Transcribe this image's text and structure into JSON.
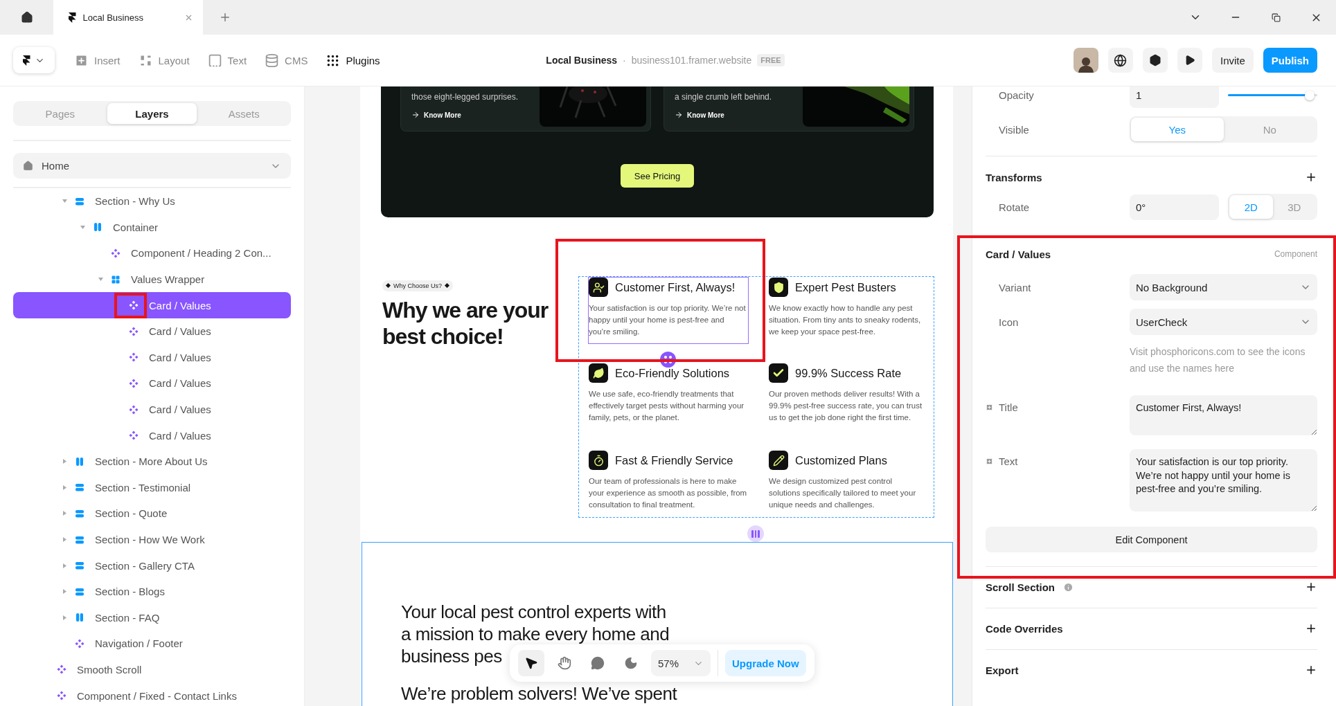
{
  "browser": {
    "tab": {
      "title": "Local Business",
      "selected": true
    }
  },
  "toolbar": {
    "tools": [
      {
        "kind": "insert",
        "label": "Insert",
        "active": false
      },
      {
        "kind": "layout",
        "label": "Layout",
        "active": false
      },
      {
        "kind": "text",
        "label": "Text",
        "active": false
      },
      {
        "kind": "cms",
        "label": "CMS",
        "active": false
      },
      {
        "kind": "plugins",
        "label": "Plugins",
        "active": true
      }
    ],
    "project": {
      "name": "Local Business",
      "separator": "·",
      "url": "business101.framer.website",
      "plan": "FREE"
    },
    "invite": "Invite",
    "publish": "Publish"
  },
  "sidebar": {
    "tabs": [
      {
        "label": "Pages",
        "selected": false
      },
      {
        "label": "Layers",
        "selected": true
      },
      {
        "label": "Assets",
        "selected": false
      }
    ],
    "page": "Home",
    "scrolled_group": [
      {
        "label": "Section - Why Us",
        "kind": "stack",
        "expanded": true,
        "selected": false,
        "children": [
          {
            "label": "Container",
            "kind": "columns",
            "expanded": true,
            "selected": false,
            "children": [
              {
                "label": "Component / Heading 2 Con...",
                "kind": "component",
                "selected": false
              },
              {
                "label": "Values Wrapper",
                "kind": "grid",
                "expanded": true,
                "selected": false,
                "children": [
                  {
                    "label": "Card / Values",
                    "kind": "component",
                    "selected": true
                  },
                  {
                    "label": "Card / Values",
                    "kind": "component",
                    "selected": false
                  },
                  {
                    "label": "Card / Values",
                    "kind": "component",
                    "selected": false
                  },
                  {
                    "label": "Card / Values",
                    "kind": "component",
                    "selected": false
                  },
                  {
                    "label": "Card / Values",
                    "kind": "component",
                    "selected": false
                  },
                  {
                    "label": "Card / Values",
                    "kind": "component",
                    "selected": false
                  }
                ]
              }
            ]
          }
        ]
      },
      {
        "label": "Section - More About Us",
        "kind": "columns",
        "expanded": false,
        "selected": false
      },
      {
        "label": "Section - Testimonial",
        "kind": "stack",
        "expanded": false,
        "selected": false
      },
      {
        "label": "Section - Quote",
        "kind": "stack",
        "expanded": false,
        "selected": false
      },
      {
        "label": "Section - How We Work",
        "kind": "stack",
        "expanded": false,
        "selected": false
      },
      {
        "label": "Section - Gallery CTA",
        "kind": "stack",
        "expanded": false,
        "selected": false
      },
      {
        "label": "Section - Blogs",
        "kind": "stack",
        "expanded": false,
        "selected": false
      },
      {
        "label": "Section - FAQ",
        "kind": "columns",
        "expanded": false,
        "selected": false
      },
      {
        "label": "Navigation / Footer",
        "kind": "component",
        "selected": false
      }
    ],
    "layers": [
      {
        "label": "Smooth Scroll",
        "kind": "component",
        "selected": false
      },
      {
        "label": "Component / Fixed - Contact Links",
        "kind": "component",
        "selected": false
      }
    ]
  },
  "canvas": {
    "services": [
      {
        "text": "those eight-legged surprises.",
        "link": "Know More"
      },
      {
        "text": "a single crumb left behind.",
        "link": "Know More"
      }
    ],
    "cta": "See Pricing",
    "why": {
      "tag": "Why Choose Us?",
      "heading": "Why we are your best choice!",
      "values": [
        {
          "kind": "user-check",
          "title": "Customer First, Always!",
          "text": "Your satisfaction is our top priority. We’re not happy until your home is pest-free and you’re smiling.",
          "selected": true
        },
        {
          "kind": "shield",
          "title": "Expert Pest Busters",
          "text": "We know exactly how to handle any pest situation. From tiny ants to sneaky rodents, we keep your space pest-free.",
          "selected": false
        },
        {
          "kind": "leaf",
          "title": "Eco-Friendly Solutions",
          "text": "We use safe, eco-friendly treatments that effectively target pests without harming your family, pets, or the planet.",
          "selected": false
        },
        {
          "kind": "check",
          "title": "99.9% Success Rate",
          "text": "Our proven methods deliver results! With a 99.9% pest-free success rate, you can trust us to get the job done right the first time.",
          "selected": false
        },
        {
          "kind": "timer",
          "title": "Fast & Friendly Service",
          "text": "Our team of professionals is here to make your experience as smooth as possible, from consultation to final treatment.",
          "selected": false
        },
        {
          "kind": "pencil",
          "title": "Customized Plans",
          "text": "We design customized pest control solutions specifically tailored to meet your unique needs and challenges.",
          "selected": false
        }
      ]
    },
    "about": {
      "intro_lines": [
        "Your local pest control experts with",
        "a mission to make every home and",
        "business pes"
      ],
      "next": "We’re problem solvers! We’ve spent"
    }
  },
  "canvas_toolbar": {
    "tools": [
      {
        "kind": "pointer",
        "selected": true
      },
      {
        "kind": "hand",
        "selected": false
      },
      {
        "kind": "comment",
        "selected": false
      },
      {
        "kind": "theme",
        "selected": false
      }
    ],
    "zoom": "57%",
    "upgrade": "Upgrade Now"
  },
  "properties": {
    "opacity": {
      "label": "Opacity",
      "value": "1",
      "level": 0.97
    },
    "visible": {
      "label": "Visible",
      "options": [
        {
          "label": "Yes",
          "selected": true
        },
        {
          "label": "No",
          "selected": false
        }
      ]
    },
    "transforms": {
      "title": "Transforms",
      "rotate_label": "Rotate",
      "rotate": "0°",
      "modes": [
        {
          "label": "2D",
          "selected": true
        },
        {
          "label": "3D",
          "selected": false
        }
      ]
    },
    "component": {
      "title": "Card / Values",
      "type": "Component",
      "variant_label": "Variant",
      "variant": "No Background",
      "icon_label": "Icon",
      "icon": "UserCheck",
      "hint": "Visit phosphoricons.com to see the icons and use the names here",
      "title_label": "Title",
      "title_value": "Customer First, Always!",
      "text_label": "Text",
      "text_value": "Your satisfaction is our top priority. We’re not happy until your home is pest-free and you’re smiling.",
      "edit": "Edit Component"
    },
    "sections": [
      {
        "title": "Scroll Section",
        "info": true
      },
      {
        "title": "Code Overrides",
        "info": false
      },
      {
        "title": "Export",
        "info": false
      }
    ]
  },
  "annotations": [
    {
      "kind": "layer_icon"
    },
    {
      "kind": "canvas_card"
    },
    {
      "kind": "properties"
    }
  ]
}
